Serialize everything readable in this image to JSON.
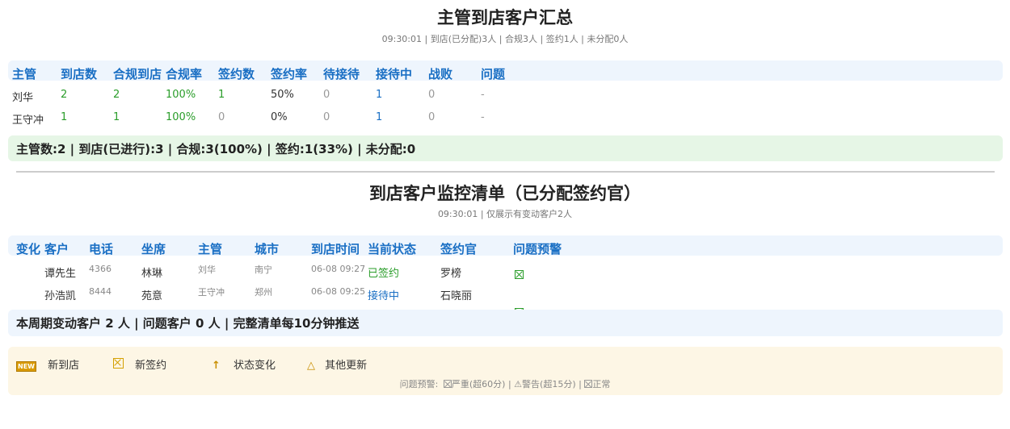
{
  "summary": {
    "title": "主管到店客户汇总",
    "subtitle": "09:30:01 | 到店(已分配)3人 | 合规3人 | 签约1人 | 未分配0人",
    "headers": [
      "主管",
      "到店数",
      "合规到店",
      "合规率",
      "签约数",
      "签约率",
      "待接待",
      "接待中",
      "战败",
      "问题"
    ],
    "rows": [
      [
        "刘华",
        "2",
        "2",
        "100%",
        "1",
        "50%",
        "0",
        "1",
        "0",
        "-"
      ],
      [
        "王守冲",
        "1",
        "1",
        "100%",
        "0",
        "0%",
        "0",
        "1",
        "0",
        "-"
      ]
    ],
    "totals": "主管数:2 | 到店(已进行):3 | 合规:3(100%) | 签约:1(33%) | 未分配:0"
  },
  "monitor": {
    "title": "到店客户监控清单（已分配签约官）",
    "subtitle": "09:30:01 | 仅展示有变动客户2人",
    "headers": [
      "变化",
      "客户",
      "电话",
      "坐席",
      "主管",
      "城市",
      "到店时间",
      "当前状态",
      "签约官",
      "问题预警"
    ],
    "rows": [
      [
        "",
        "谭先生",
        "4366",
        "林琳",
        "刘华",
        "南宁",
        "06-08 09:27",
        "已签约",
        "罗榜",
        ""
      ],
      [
        "",
        "孙浩凯",
        "8444",
        "苑意",
        "王守冲",
        "郑州",
        "06-08 09:25",
        "接待中",
        "石晓丽",
        ""
      ]
    ],
    "footer": "本周期变动客户 2 人 | 问题客户 0 人 | 完整清单每10分钟推送"
  },
  "legend": {
    "items": [
      {
        "icon": "new-icon",
        "badge": "NEW",
        "label": "新到店"
      },
      {
        "icon": "box-icon",
        "label": "新签约"
      },
      {
        "icon": "up-arrow-icon",
        "glyph": "↑",
        "label": "状态变化"
      },
      {
        "icon": "triangle-icon",
        "glyph": "△",
        "label": "其他更新"
      }
    ],
    "note_prefix": "问题预警:",
    "note_severe": "严重(超60分)",
    "note_sep1": "|",
    "note_warn_glyph": "⚠",
    "note_warn": "警告(超15分)",
    "note_sep2": "|",
    "note_normal": "正常"
  },
  "colors": {
    "accent_blue": "#1a6fc4",
    "green": "#2a9d2a",
    "summary_bar": "#e6f6e6",
    "header_bar": "#eef5fd",
    "legend_bg": "#fdf6e5"
  }
}
